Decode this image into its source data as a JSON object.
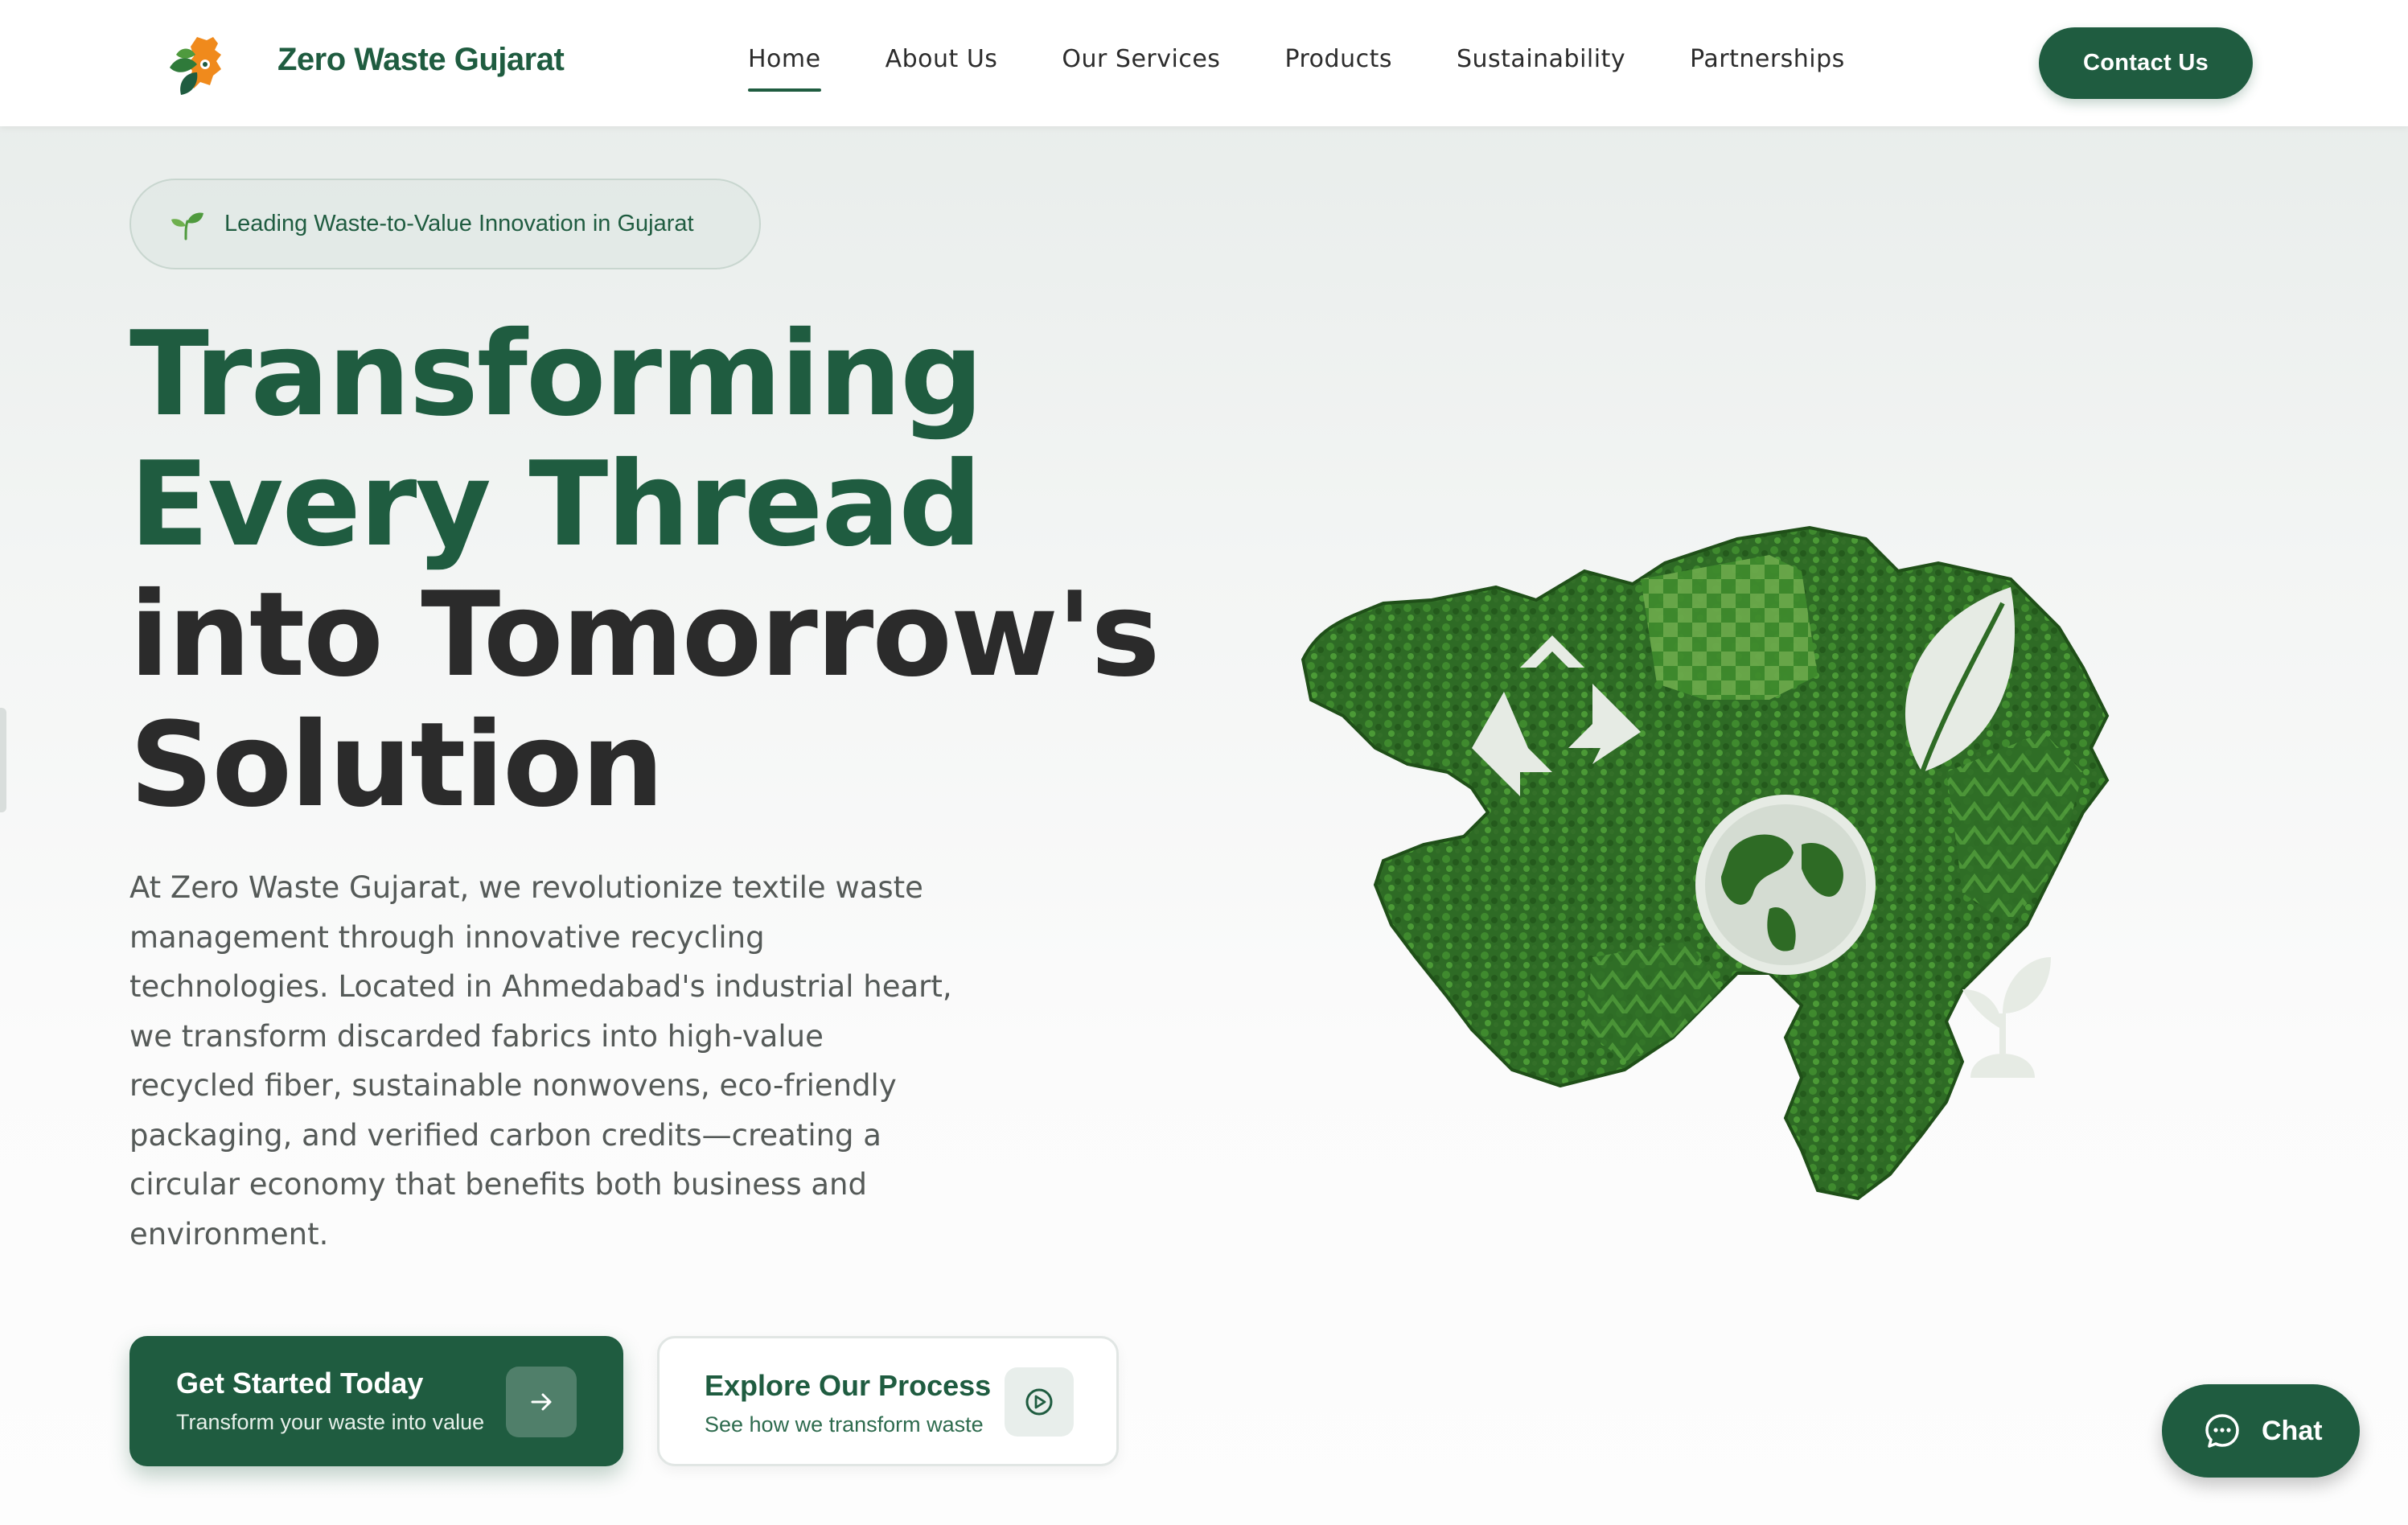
{
  "header": {
    "brand": "Zero Waste Gujarat",
    "logo_icon": "gujarat-leaf-logo-icon",
    "nav": [
      {
        "label": "Home",
        "active": true
      },
      {
        "label": "About Us",
        "active": false
      },
      {
        "label": "Our Services",
        "active": false
      },
      {
        "label": "Products",
        "active": false
      },
      {
        "label": "Sustainability",
        "active": false
      },
      {
        "label": "Partnerships",
        "active": false
      }
    ],
    "contact_label": "Contact Us"
  },
  "hero": {
    "badge": {
      "icon": "sprout-icon",
      "text": "Leading Waste-to-Value Innovation in Gujarat"
    },
    "headline": {
      "line1": "Transforming",
      "line2": "Every Thread",
      "line3": "into Tomorrow's",
      "line4": "Solution"
    },
    "description": "At Zero Waste Gujarat, we revolutionize textile waste management through innovative recycling technologies. Located in Ahmedabad's industrial heart, we transform discarded fabrics into high-value recycled fiber, sustainable nonwovens, eco-friendly packaging, and verified carbon credits—creating a circular economy that benefits both business and environment.",
    "primary_cta": {
      "title": "Get Started Today",
      "subtitle": "Transform your waste into value",
      "icon": "arrow-right-icon"
    },
    "secondary_cta": {
      "title": "Explore Our Process",
      "subtitle": "See how we transform waste",
      "icon": "play-circle-icon"
    },
    "image": {
      "subject": "gujarat-green-map-illustration",
      "icons": [
        "recycle-icon",
        "leaf-icon",
        "globe-icon",
        "seedling-icon"
      ]
    }
  },
  "chat": {
    "label": "Chat",
    "icon": "chat-bubble-icon"
  },
  "colors": {
    "brand_green": "#1f5c40",
    "text_dark": "#2b2b2b",
    "text_muted": "#555a58",
    "accent_orange": "#f08a1c"
  }
}
